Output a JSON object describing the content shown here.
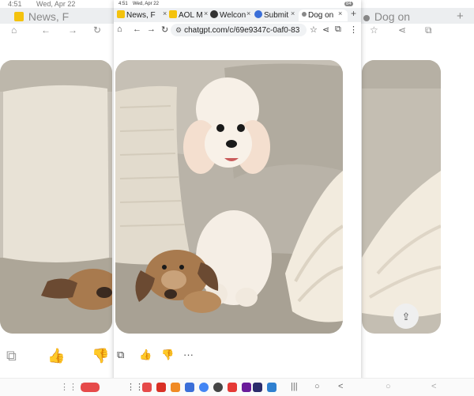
{
  "status": {
    "time": "4:51",
    "date": "Wed, Apr 22",
    "battery": "84"
  },
  "tabs": [
    {
      "label": "News, F",
      "favicon_color": "#f4c20d"
    },
    {
      "label": "AOL M",
      "favicon_color": "#f4c20d"
    },
    {
      "label": "Welcon",
      "favicon_color": "#333333"
    },
    {
      "label": "Submit",
      "favicon_color": "#3b6fd8"
    },
    {
      "label": "Dog on",
      "favicon_color": "#888888"
    }
  ],
  "bg_tabs": {
    "left": "News, F",
    "right": "Dog on"
  },
  "url": "chatgpt.com/c/69e9347c-0af0-83",
  "icons": {
    "home": "⌂",
    "back": "←",
    "forward": "→",
    "reload": "↻",
    "lock": "⚙",
    "star": "☆",
    "share_url": "⋖",
    "tab_count": "⧉",
    "menu": "⋮",
    "new_tab": "+",
    "close": "×",
    "copy": "⧉",
    "thumb_up": "👍",
    "thumb_down": "👎",
    "more": "···",
    "download_share": "⇪"
  },
  "dock": {
    "apps_grid": "⋮⋮⋮",
    "nav_recent": "|||",
    "nav_home": "○",
    "nav_back": "<"
  },
  "colors": {
    "tab_strip": "#eef0f2",
    "url_field": "#f0f2f4",
    "sofa": "#b8b2a6",
    "dog": "#f4ece2",
    "plush": "#a87a4e"
  }
}
